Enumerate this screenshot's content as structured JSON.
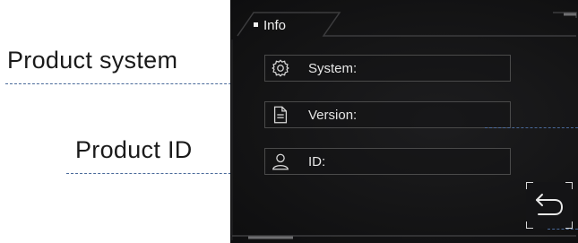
{
  "callouts": {
    "product_system": "Product system",
    "product_id": "Product ID"
  },
  "info_tab": {
    "label": "Info"
  },
  "fields": [
    {
      "icon": "gear-icon",
      "label": "System:"
    },
    {
      "icon": "document-icon",
      "label": "Version:"
    },
    {
      "icon": "user-icon",
      "label": "ID:"
    }
  ],
  "back_button": {
    "icon": "back-arrow-icon"
  },
  "colors": {
    "background": "#141415",
    "text": "#e6e6e6",
    "leader_line": "#4a6a9a"
  }
}
